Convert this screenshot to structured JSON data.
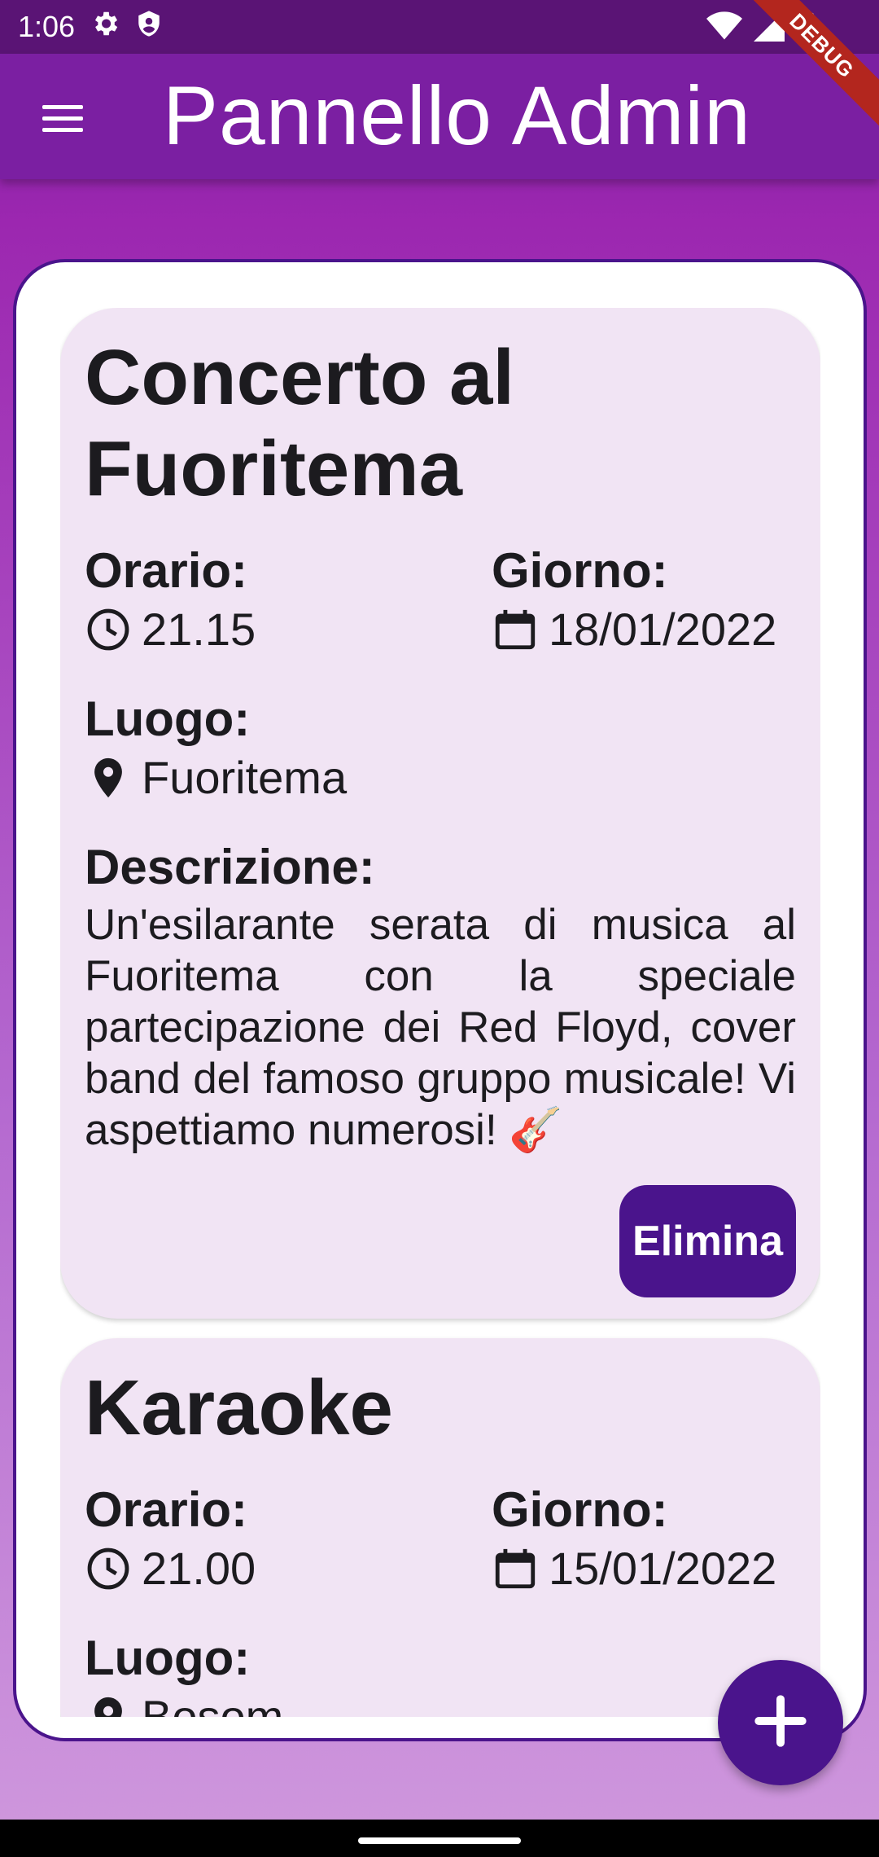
{
  "status_bar": {
    "time": "1:06",
    "debug_label": "DEBUG"
  },
  "app_bar": {
    "title": "Pannello Admin"
  },
  "events": [
    {
      "title": "Concerto al Fuoritema",
      "time_label": "Orario:",
      "time": "21.15",
      "date_label": "Giorno:",
      "date": "18/01/2022",
      "place_label": "Luogo:",
      "place": "Fuoritema",
      "desc_label": "Descrizione:",
      "description": "Un'esilarante serata di musica al Fuoritema con la speciale partecipazione dei Red Floyd, cover band del famoso gruppo musicale! Vi aspettiamo numerosi! 🎸",
      "delete_label": "Elimina"
    },
    {
      "title": "Karaoke",
      "time_label": "Orario:",
      "time": "21.00",
      "date_label": "Giorno:",
      "date": "15/01/2022",
      "place_label": "Luogo:",
      "place": "Bosom"
    }
  ],
  "colors": {
    "primary": "#7b1fa2",
    "dark": "#4a148c",
    "card": "#f1e4f4"
  },
  "icons": {
    "menu": "menu-icon",
    "clock": "clock-icon",
    "calendar": "calendar-icon",
    "place": "location-pin-icon",
    "add": "add-icon"
  }
}
